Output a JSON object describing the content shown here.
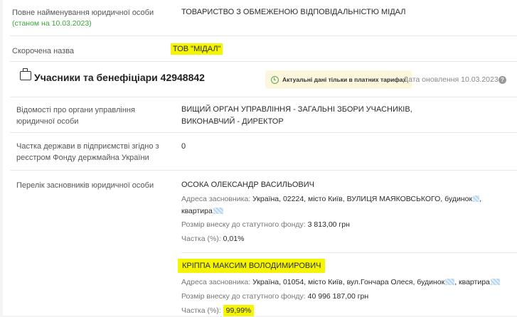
{
  "top": {
    "full_name_label": "Повне найменування юридичної особи",
    "full_name_date": "(станом на 10.03.2023)",
    "full_name_value": "ТОВАРИСТВО З ОБМЕЖЕНОЮ ВІДПОВІДАЛЬНІСТЮ МІДАЛ",
    "short_name_label": "Скорочена назва",
    "short_name_value": "ТОВ \"МІДАЛ\""
  },
  "section": {
    "title": "Учасники та бенефіціари 42948842",
    "badge_text": "Актуальні дані тільки в платних тарифах",
    "updated": "Дата оновлення 10.03.2023",
    "help": "?"
  },
  "rows": {
    "governance_label": "Відомості про органи управління юридичної особи",
    "governance_value": "ВИЩИЙ ОРГАН УПРАВЛІННЯ - ЗАГАЛЬНІ ЗБОРИ УЧАСНИКІВ, ВИКОНАВЧИЙ - ДИРЕКТОР",
    "state_share_label": "Частка держави в підприємстві згідно з реєстром Фонду держмайна України",
    "state_share_value": "0",
    "founders_label": "Перелік засновників юридичної особи"
  },
  "founders": [
    {
      "name": "ОСОКА ОЛЕКСАНДР ВАСИЛЬОВИЧ",
      "address_label": "Адреса засновника:",
      "address_value": "Україна, 02224, місто Київ, ВУЛИЦЯ МАЯКОВСЬКОГО, будинок",
      "address_apt": "квартира",
      "capital_label": "Розмір внеску до статутного фонду:",
      "capital_value": "3 813,00 грн",
      "share_label": "Частка (%):",
      "share_value": "0,01%"
    },
    {
      "name": "КРІППА МАКСИМ ВОЛОДИМИРОВИЧ",
      "address_label": "Адреса засновника:",
      "address_value": "Україна, 01054, місто Київ, вул.Гончара Олеся, будинок",
      "address_apt": ", квартира",
      "capital_label": "Розмір внеску до статутного фонду:",
      "capital_value": "40 996 187,00 грн",
      "share_label": "Частка (%):",
      "share_value": "99,99%"
    }
  ],
  "colors": {
    "highlight": "#f5f500",
    "accent_green": "#3aa43a",
    "badge_bg": "#fbf6dc"
  }
}
